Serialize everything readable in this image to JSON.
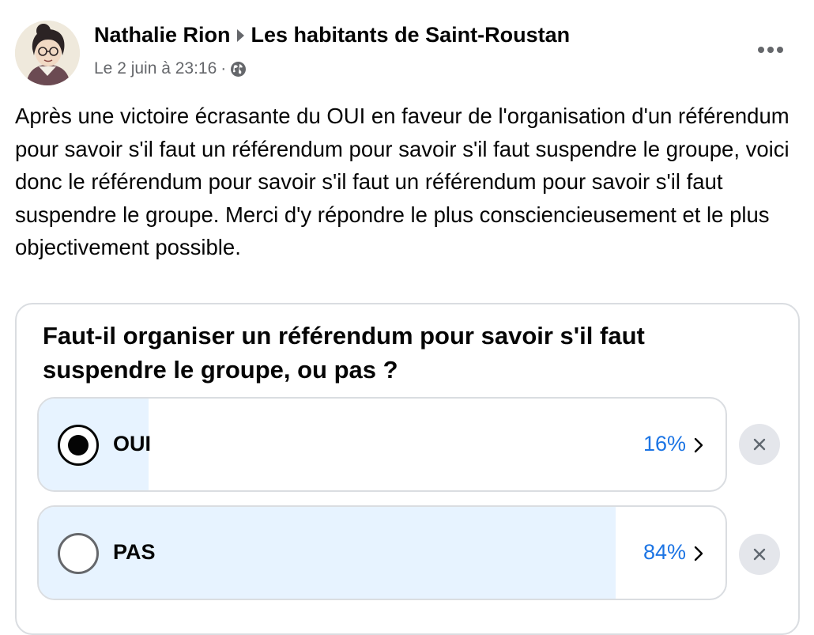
{
  "post": {
    "author": "Nathalie Rion",
    "group": "Les habitants de Saint-Roustan",
    "timestamp": "Le 2 juin à 23:16",
    "separator": "·",
    "privacy_icon": "globe-icon",
    "more_icon": "more-dots-icon",
    "text": "Après une victoire écrasante du OUI en faveur de l'organisation d'un référendum pour savoir s'il faut un référendum pour savoir s'il faut suspendre le groupe, voici donc le référendum pour savoir s'il faut un référendum pour savoir s'il faut suspendre le groupe. Merci d'y répondre le plus consciencieusement et le plus objectivement possible."
  },
  "poll": {
    "question": "Faut-il organiser un référendum pour savoir s'il faut suspendre le groupe, ou pas ?",
    "options": [
      {
        "label": "OUI",
        "percent_label": "16%",
        "share": 0.16,
        "selected": true
      },
      {
        "label": "PAS",
        "percent_label": "84%",
        "share": 0.84,
        "selected": false
      }
    ]
  },
  "colors": {
    "accent": "#1b74e4",
    "poll_fill": "#e7f3ff",
    "secondary_text": "#65676b"
  }
}
